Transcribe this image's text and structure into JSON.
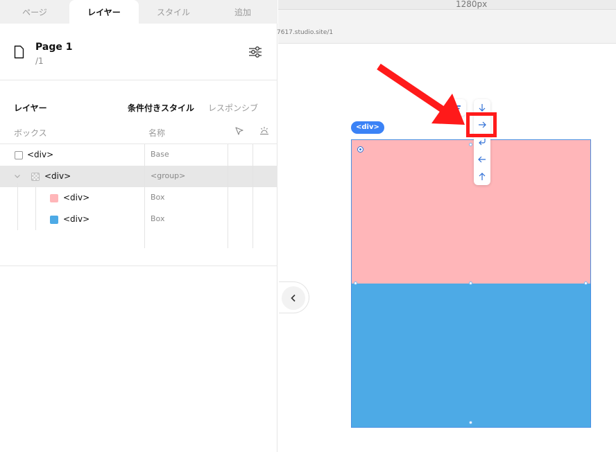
{
  "tabs": [
    {
      "label": "ページ"
    },
    {
      "label": "レイヤー"
    },
    {
      "label": "スタイル"
    },
    {
      "label": "追加"
    }
  ],
  "page": {
    "name": "Page 1",
    "path": "/1"
  },
  "layers": {
    "title": "レイヤー",
    "conditional_style": "条件付きスタイル",
    "responsive": "レスポンシブ"
  },
  "columns": {
    "box": "ボックス",
    "name": "名称"
  },
  "rows": [
    {
      "label": "<div>",
      "type": "Base"
    },
    {
      "label": "<div>",
      "type": "<group>"
    },
    {
      "label": "<div>",
      "type": "Box",
      "color": "#ffb6b9"
    },
    {
      "label": "<div>",
      "type": "Box",
      "color": "#4daae6"
    }
  ],
  "canvas": {
    "ruler_label": "1280px",
    "url": "7617.studio.site/1",
    "selection_tag": "<div>",
    "pink_color": "#ffb6b9",
    "blue_color": "#4daae6",
    "direction_menu": [
      "arrow-down-icon",
      "arrow-right-icon",
      "wrap-icon",
      "arrow-left-icon",
      "arrow-up-icon"
    ],
    "highlight_color": "#ff1a1a"
  }
}
